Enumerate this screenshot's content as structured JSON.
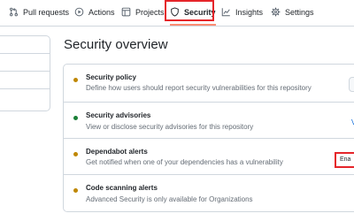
{
  "tabs": [
    {
      "label": "Pull requests",
      "icon": "pull-request-icon"
    },
    {
      "label": "Actions",
      "icon": "play-icon"
    },
    {
      "label": "Projects",
      "icon": "table-icon"
    },
    {
      "label": "Security",
      "icon": "shield-icon",
      "active": true
    },
    {
      "label": "Insights",
      "icon": "graph-icon"
    },
    {
      "label": "Settings",
      "icon": "gear-icon"
    }
  ],
  "page_title": "Security overview",
  "rows": [
    {
      "title": "Security policy",
      "description": "Define how users should report security vulnerabilities for this repository",
      "status_color": "#bf8700"
    },
    {
      "title": "Security advisories",
      "description": "View or disclose security advisories for this repository",
      "status_color": "#1a7f37",
      "action_partial": "V"
    },
    {
      "title": "Dependabot alerts",
      "description": "Get notified when one of your dependencies has a vulnerability",
      "status_color": "#bf8700",
      "action_partial": "Ena"
    },
    {
      "title": "Code scanning alerts",
      "description": "Advanced Security is only available for Organizations",
      "status_color": "#bf8700"
    }
  ],
  "colors": {
    "highlight": "#e5252a",
    "active_underline": "#fd8c73"
  }
}
